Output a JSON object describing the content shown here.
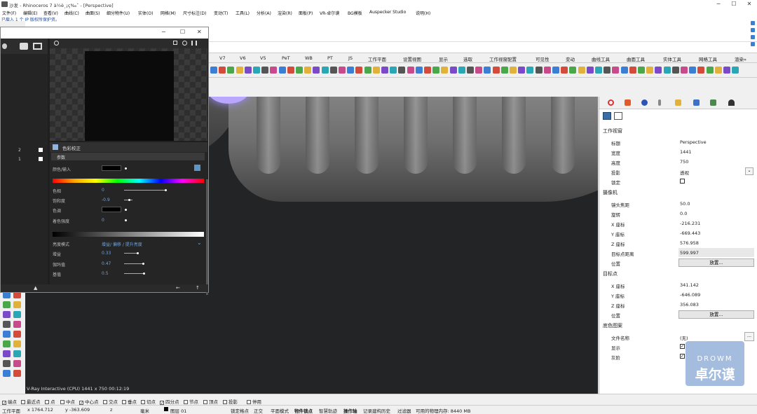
{
  "window": {
    "title": "沙发 - Rhinoceros 7 à½è¸¡ç‰ˆ - [Perspective]",
    "minimize": "─",
    "maximize": "☐",
    "close": "✕"
  },
  "menu": [
    "文件(F)",
    "编辑(E)",
    "查看(V)",
    "曲线(C)",
    "曲面(S)",
    "细分物件(U)",
    "实体(O)",
    "网格(M)",
    "尺寸标注(D)",
    "变动(T)",
    "工具(L)",
    "分析(A)",
    "渲染(R)",
    "面板(P)",
    "VR-卓尔谟",
    "BG模板",
    "Auspecker Studio",
    "说明(H)"
  ],
  "command": {
    "history": "已载入 1 个 IP 版权所保护资。"
  },
  "toolbar_tabs": [
    "V7",
    "V6",
    "V5",
    "PeT",
    "WB",
    "PT",
    "JS",
    "工作平面",
    "设置视图",
    "显示",
    "选取",
    "工作视窗配置",
    "可见性",
    "变动",
    "曲线工具",
    "曲面工具",
    "实体工具",
    "网格工具",
    "渲染»"
  ],
  "vray": {
    "win_min": "─",
    "win_max": "☐",
    "win_close": "✕",
    "layer_nums": [
      "2",
      "1"
    ],
    "section": "色彩校正",
    "sub": "参数",
    "color_input": "颜色/输入",
    "rows": [
      {
        "label": "色相",
        "value": "0"
      },
      {
        "label": "饱和度",
        "value": "-0.9"
      },
      {
        "label": "色调",
        "value": ""
      },
      {
        "label": "着色强度",
        "value": "0"
      }
    ],
    "tone_label": "亮度模式",
    "tone_value": "增益/ 偏移 / 提升亮度",
    "rows2": [
      {
        "label": "增益",
        "value": "0.33"
      },
      {
        "label": "伽玛值",
        "value": "0.47"
      },
      {
        "label": "基值",
        "value": "0.5"
      }
    ],
    "saturation_level": -0.9,
    "hue_level": 0
  },
  "viewport": {
    "info": "V-Ray Interactive (CPU)   1441 x 750   00:12:19"
  },
  "props": {
    "s1": "工作视窗",
    "title_l": "标题",
    "title_v": "Perspective",
    "w_l": "宽度",
    "w_v": "1441",
    "h_l": "高度",
    "h_v": "750",
    "proj_l": "投影",
    "proj_v": "透视",
    "lock_l": "锁定",
    "s2": "摄像机",
    "lens_l": "镜头焦距",
    "lens_v": "50.0",
    "rot_l": "旋转",
    "rot_v": "0.0",
    "cx_l": "X 座标",
    "cx_v": "-216.231",
    "cy_l": "Y 座标",
    "cy_v": "-669.443",
    "cz_l": "Z 座标",
    "cz_v": "576.958",
    "td_l": "目标点距离",
    "td_v": "599.997",
    "pos_l": "位置",
    "pos_btn": "放置...",
    "s3": "目标点",
    "tx_l": "X 座标",
    "tx_v": "341.142",
    "ty_l": "Y 座标",
    "ty_v": "-646.089",
    "tz_l": "Z 座标",
    "tz_v": "356.083",
    "tpos_l": "位置",
    "tpos_btn": "放置...",
    "s4": "底色图案",
    "fn_l": "文件名称",
    "fn_v": "(无)",
    "fn_btn": "...",
    "show_l": "显示",
    "gray_l": "灰阶"
  },
  "watermark": {
    "a": "DROWM",
    "b": "卓尔谟"
  },
  "osnap": [
    "端点",
    "最近点",
    "点",
    "中点",
    "中心点",
    "交点",
    "垂点",
    "切点",
    "四分点",
    "节点",
    "顶点",
    "投影",
    "停用"
  ],
  "osnap_checked": [
    true,
    false,
    false,
    false,
    true,
    false,
    false,
    false,
    true,
    false,
    false,
    false,
    false
  ],
  "status": {
    "cplane": "工作平面",
    "x": "x 1764.712",
    "y": "y -363.609",
    "z": "z",
    "unit": "毫米",
    "layer": "图层 01",
    "items": [
      "锁定格点",
      "正交",
      "平面模式",
      "物件锁点",
      "智慧轨迹",
      "操作轴",
      "记录建构历史",
      "过滤器",
      "可用的物理内存: 8440 MB"
    ]
  }
}
